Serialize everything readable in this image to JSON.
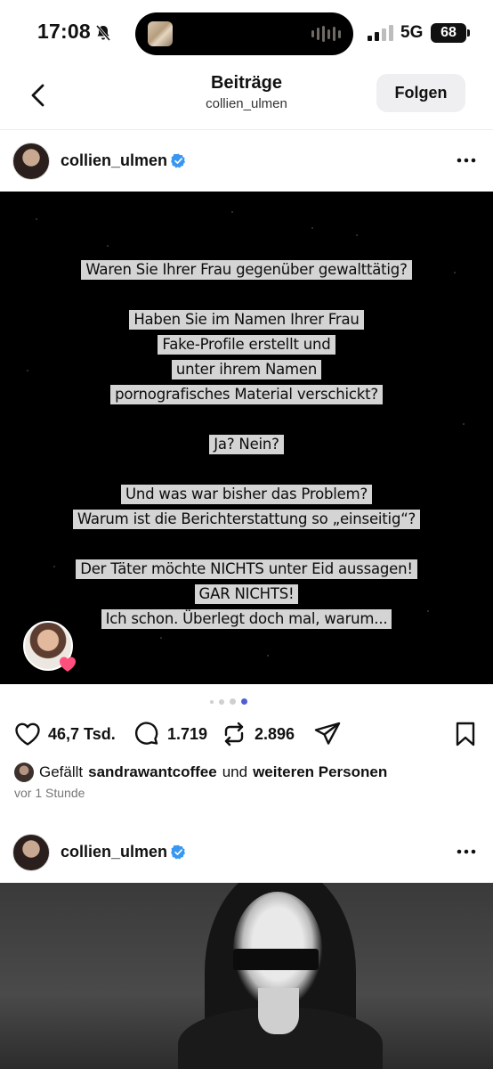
{
  "status_bar": {
    "time": "17:08",
    "network": "5G",
    "battery": "68",
    "icons": [
      "bell-slash-icon",
      "signal-icon"
    ]
  },
  "header": {
    "title": "Beiträge",
    "subtitle": "collien_ulmen",
    "follow_label": "Folgen"
  },
  "post": {
    "username": "collien_ulmen",
    "image_text": [
      "Waren Sie Ihrer Frau gegenüber gewalttätig?",
      "",
      "Haben Sie im Namen Ihrer Frau",
      "Fake-Profile erstellt und",
      "unter ihrem Namen",
      "pornografisches Material verschickt?",
      "",
      "Ja? Nein?",
      "",
      "Und was war bisher das Problem?",
      "Warum ist die Berichterstattung so „einseitig“?",
      "",
      "Der Täter möchte NICHTS unter Eid aussagen!",
      "GAR NICHTS!",
      "Ich schon. Überlegt doch mal, warum..."
    ],
    "carousel_active_index": 3,
    "carousel_count": 4,
    "likes_count": "46,7 Tsd.",
    "comments_count": "1.719",
    "reposts_count": "2.896",
    "liked_by_prefix": "Gefällt",
    "liked_by_user": "sandrawantcoffee",
    "liked_by_and": "und",
    "liked_by_others": "weiteren Personen",
    "time_ago": "vor 1 Stunde"
  },
  "post2": {
    "username": "collien_ulmen"
  },
  "colors": {
    "verified_blue": "#3897f0",
    "active_dot": "#4c5fd5",
    "heart_badge": "#ff4f7d"
  }
}
